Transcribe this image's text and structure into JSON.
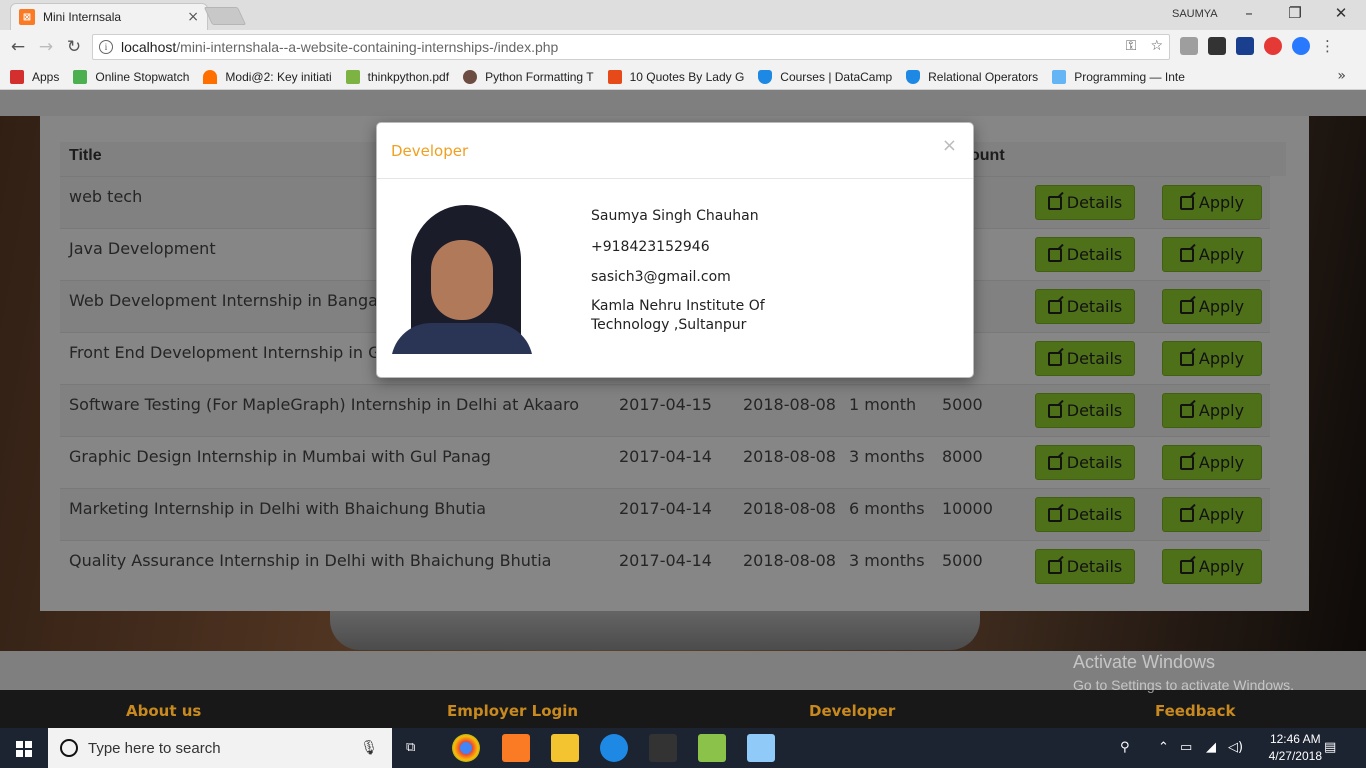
{
  "browser": {
    "tab_title": "Mini Internsala",
    "tab_close": "×",
    "profile": "SAUMYA",
    "url_host": "localhost",
    "url_path": "/mini-internshala--a-website-containing-internships-/index.php",
    "bookmarks": [
      {
        "label": "Apps",
        "color": "#d32f2f"
      },
      {
        "label": "Online Stopwatch",
        "color": "#4caf50"
      },
      {
        "label": "Modi@2: Key initiati",
        "color": "#ff6f00"
      },
      {
        "label": "thinkpython.pdf",
        "color": "#7cb342"
      },
      {
        "label": "Python Formatting T",
        "color": "#6d4c41"
      },
      {
        "label": "10 Quotes By Lady G",
        "color": "#e64a19"
      },
      {
        "label": "Courses | DataCamp",
        "color": "#1e88e5"
      },
      {
        "label": "Relational Operators",
        "color": "#1e88e5"
      },
      {
        "label": "Programming — Inte",
        "color": "#64b5f6"
      }
    ]
  },
  "table": {
    "headers": {
      "title": "Title",
      "amount": "ount"
    },
    "rows": [
      {
        "title": "web tech",
        "start": "",
        "end": "",
        "duration": "",
        "amount": "00"
      },
      {
        "title": "Java Development",
        "start": "",
        "end": "",
        "duration": "",
        "amount": "0"
      },
      {
        "title": "Web Development Internship in Bangalo",
        "start": "",
        "end": "",
        "duration": "",
        "amount": "0"
      },
      {
        "title": "Front End Development Internship in Gu",
        "start": "",
        "end": "",
        "duration": "",
        "amount": "0"
      },
      {
        "title": "Software Testing (For MapleGraph) Internship in Delhi at Akaaro",
        "start": "2017-04-15",
        "end": "2018-08-08",
        "duration": "1 month",
        "amount": "5000"
      },
      {
        "title": "Graphic Design Internship in Mumbai with Gul Panag",
        "start": "2017-04-14",
        "end": "2018-08-08",
        "duration": "3 months",
        "amount": "8000"
      },
      {
        "title": "Marketing Internship in Delhi with Bhaichung Bhutia",
        "start": "2017-04-14",
        "end": "2018-08-08",
        "duration": "6 months",
        "amount": "10000"
      },
      {
        "title": "Quality Assurance Internship in Delhi with Bhaichung Bhutia",
        "start": "2017-04-14",
        "end": "2018-08-08",
        "duration": "3 months",
        "amount": "5000"
      }
    ],
    "details_label": "Details",
    "apply_label": "Apply"
  },
  "modal": {
    "title": "Developer",
    "close": "×",
    "name": "Saumya Singh Chauhan",
    "phone": "+918423152946",
    "email": "sasich3@gmail.com",
    "college_line1": "Kamla Nehru Institute Of",
    "college_line2": "Technology ,Sultanpur"
  },
  "footer": {
    "about": "About us",
    "employer": "Employer Login",
    "developer": "Developer",
    "feedback": "Feedback"
  },
  "watermark": {
    "line1": "Activate Windows",
    "line2": "Go to Settings to activate Windows."
  },
  "taskbar": {
    "search_placeholder": "Type here to search",
    "time": "12:46 AM",
    "date": "4/27/2018"
  },
  "colors": {
    "accent_orange": "#f0a020",
    "button_green": "#8ccc2d"
  }
}
